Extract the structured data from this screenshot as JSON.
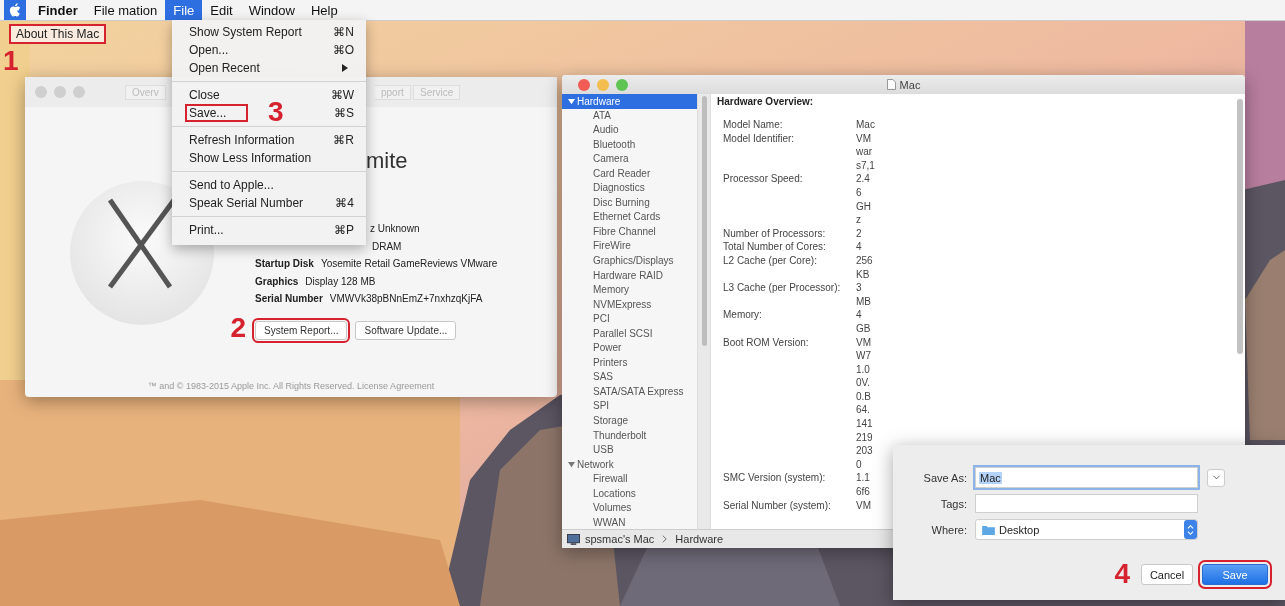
{
  "menu_bar": {
    "items": [
      {
        "kind": "apple",
        "selected": true
      },
      {
        "kind": "app",
        "label": "Finder",
        "selected": false
      },
      {
        "kind": "menu",
        "label": "File mation",
        "selected": false
      },
      {
        "kind": "menu",
        "label": "File",
        "selected": true
      },
      {
        "kind": "menu",
        "label": "Edit",
        "selected": false
      },
      {
        "kind": "menu",
        "label": "Window",
        "selected": false
      },
      {
        "kind": "menu",
        "label": "Help",
        "selected": false
      }
    ]
  },
  "apple_menu": {
    "items": [
      {
        "label": "About This Mac",
        "highlighted": true,
        "step": "1"
      }
    ]
  },
  "file_menu": {
    "groups": [
      [
        {
          "label": "Show System Report",
          "shortcut": "⌘N",
          "has_submenu": false,
          "highlighted": false
        },
        {
          "label": "Open...",
          "shortcut": "⌘O",
          "has_submenu": false,
          "highlighted": false
        },
        {
          "label": "Open Recent",
          "has_submenu": true,
          "highlighted": false
        }
      ],
      [
        {
          "label": "Close",
          "shortcut": "⌘W",
          "has_submenu": false,
          "highlighted": false
        },
        {
          "label": "Save...",
          "shortcut": "⌘S",
          "has_submenu": false,
          "highlighted": true,
          "step": "3"
        }
      ],
      [
        {
          "label": "Refresh Information",
          "shortcut": "⌘R",
          "has_submenu": false,
          "highlighted": false
        },
        {
          "label": "Show Less Information",
          "has_submenu": false,
          "highlighted": false
        }
      ],
      [
        {
          "label": "Send to Apple...",
          "has_submenu": false,
          "highlighted": false
        },
        {
          "label": "Speak Serial Number",
          "shortcut": "⌘4",
          "has_submenu": false,
          "highlighted": false
        }
      ],
      [
        {
          "label": "Print...",
          "shortcut": "⌘P",
          "has_submenu": false,
          "highlighted": false
        }
      ]
    ]
  },
  "about_window": {
    "tabs": [
      {
        "label": "Overv"
      },
      {
        "label": "pport"
      },
      {
        "label": "Service"
      }
    ],
    "title": "mite",
    "specs": [
      {
        "value": "z Unknown"
      },
      {
        "value": "DRAM"
      },
      {
        "label": "Startup Disk",
        "value": "Yosemite Retail GameReviews VMware"
      },
      {
        "label": "Graphics",
        "value": "Display 128 MB"
      },
      {
        "label": "Serial Number",
        "value": "VMWVk38pBNnEmZ+7nxhzqKjFA"
      }
    ],
    "buttons": [
      {
        "label": "System Report...",
        "highlighted": true,
        "step": "2"
      },
      {
        "label": "Software Update...",
        "highlighted": false
      }
    ],
    "footer": "™ and © 1983-2015 Apple Inc. All Rights Reserved. License Agreement"
  },
  "system_report": {
    "title": "Mac",
    "sidebar": [
      {
        "label": "Hardware",
        "expanded": true,
        "selected": true,
        "children": [
          {
            "label": "ATA",
            "selected": false
          },
          {
            "label": "Audio",
            "selected": false
          },
          {
            "label": "Bluetooth",
            "selected": false
          },
          {
            "label": "Camera",
            "selected": false
          },
          {
            "label": "Card Reader",
            "selected": false
          },
          {
            "label": "Diagnostics",
            "selected": false
          },
          {
            "label": "Disc Burning",
            "selected": false
          },
          {
            "label": "Ethernet Cards",
            "selected": false
          },
          {
            "label": "Fibre Channel",
            "selected": false
          },
          {
            "label": "FireWire",
            "selected": false
          },
          {
            "label": "Graphics/Displays",
            "selected": false
          },
          {
            "label": "Hardware RAID",
            "selected": false
          },
          {
            "label": "Memory",
            "selected": false
          },
          {
            "label": "NVMExpress",
            "selected": false
          },
          {
            "label": "PCI",
            "selected": false
          },
          {
            "label": "Parallel SCSI",
            "selected": false
          },
          {
            "label": "Power",
            "selected": false
          },
          {
            "label": "Printers",
            "selected": false
          },
          {
            "label": "SAS",
            "selected": false
          },
          {
            "label": "SATA/SATA Express",
            "selected": false
          },
          {
            "label": "SPI",
            "selected": false
          },
          {
            "label": "Storage",
            "selected": false
          },
          {
            "label": "Thunderbolt",
            "selected": false
          },
          {
            "label": "USB",
            "selected": false
          }
        ]
      },
      {
        "label": "Network",
        "expanded": true,
        "selected": false,
        "children": [
          {
            "label": "Firewall",
            "selected": false
          },
          {
            "label": "Locations",
            "selected": false
          },
          {
            "label": "Volumes",
            "selected": false
          },
          {
            "label": "WWAN",
            "selected": false
          }
        ]
      }
    ],
    "overview_title": "Hardware Overview:",
    "rows": [
      {
        "label": "Model Name:",
        "value_lines": [
          "Mac"
        ]
      },
      {
        "label": "Model Identifier:",
        "value_lines": [
          "VM",
          "war",
          "s7,1"
        ]
      },
      {
        "label": "Processor Speed:",
        "value_lines": [
          "2.4",
          "6",
          "GH",
          "z"
        ]
      },
      {
        "label": "Number of Processors:",
        "value_lines": [
          "2"
        ]
      },
      {
        "label": "Total Number of Cores:",
        "value_lines": [
          "4"
        ]
      },
      {
        "label": "L2 Cache (per Core):",
        "value_lines": [
          "256",
          "KB"
        ]
      },
      {
        "label": "L3 Cache (per Processor):",
        "value_lines": [
          "3",
          "MB"
        ]
      },
      {
        "label": "Memory:",
        "value_lines": [
          "4",
          "GB"
        ]
      },
      {
        "label": "Boot ROM Version:",
        "value_lines": [
          "VM",
          "W7",
          "1.0",
          "0V.",
          "0.B",
          "64.",
          "141",
          "219",
          "203",
          "0"
        ]
      },
      {
        "label": "SMC Version (system):",
        "value_lines": [
          "1.1",
          "6f6"
        ]
      },
      {
        "label": "Serial Number (system):",
        "value_lines": [
          "VM"
        ]
      }
    ],
    "path": [
      "spsmac's Mac",
      "Hardware"
    ]
  },
  "save_dialog": {
    "fields": [
      {
        "kind": "text",
        "label": "Save As:",
        "value": "Mac"
      },
      {
        "kind": "tags",
        "label": "Tags:"
      },
      {
        "kind": "popup",
        "label": "Where:",
        "value": "Desktop"
      }
    ],
    "buttons": [
      {
        "label": "Cancel",
        "default": false,
        "highlighted": false
      },
      {
        "label": "Save",
        "default": true,
        "highlighted": true,
        "step": "4"
      }
    ]
  }
}
